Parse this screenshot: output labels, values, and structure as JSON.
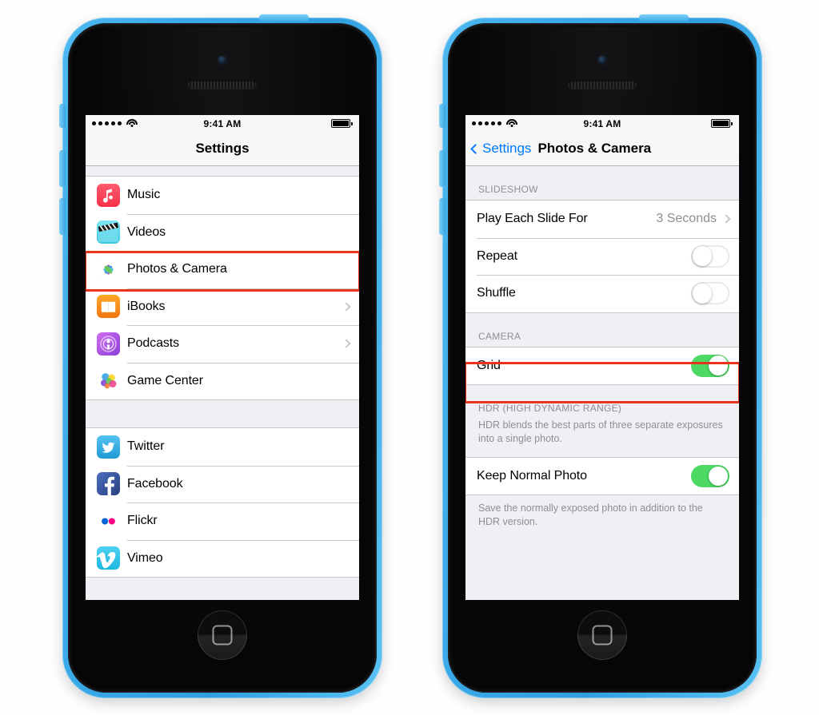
{
  "phones": {
    "left": {
      "status_bar": {
        "signal_dots": 5,
        "wifi": "wifi-icon",
        "time": "9:41 AM",
        "battery": "battery-full-icon"
      },
      "nav": {
        "title": "Settings"
      },
      "groups": [
        {
          "rows": [
            {
              "label": "Music",
              "icon": "music-app-icon",
              "accessory": "none"
            },
            {
              "label": "Videos",
              "icon": "videos-app-icon",
              "accessory": "none"
            },
            {
              "label": "Photos & Camera",
              "icon": "photos-app-icon",
              "accessory": "none",
              "highlighted": true
            },
            {
              "label": "iBooks",
              "icon": "ibooks-app-icon",
              "accessory": "chevron"
            },
            {
              "label": "Podcasts",
              "icon": "podcasts-app-icon",
              "accessory": "chevron"
            },
            {
              "label": "Game Center",
              "icon": "gamecenter-app-icon",
              "accessory": "none"
            }
          ]
        },
        {
          "rows": [
            {
              "label": "Twitter",
              "icon": "twitter-app-icon",
              "accessory": "none"
            },
            {
              "label": "Facebook",
              "icon": "facebook-app-icon",
              "accessory": "none"
            },
            {
              "label": "Flickr",
              "icon": "flickr-app-icon",
              "accessory": "none"
            },
            {
              "label": "Vimeo",
              "icon": "vimeo-app-icon",
              "accessory": "none"
            }
          ]
        }
      ]
    },
    "right": {
      "status_bar": {
        "signal_dots": 5,
        "wifi": "wifi-icon",
        "time": "9:41 AM",
        "battery": "battery-full-icon"
      },
      "nav": {
        "back_label": "Settings",
        "back_icon": "chevron-left-icon",
        "title": "Photos & Camera"
      },
      "sections": [
        {
          "header": "SLIDESHOW",
          "rows": [
            {
              "label": "Play Each Slide For",
              "value": "3 Seconds",
              "accessory": "chevron"
            },
            {
              "label": "Repeat",
              "accessory": "switch",
              "switch_on": false
            },
            {
              "label": "Shuffle",
              "accessory": "switch",
              "switch_on": false
            }
          ]
        },
        {
          "header": "CAMERA",
          "rows": [
            {
              "label": "Grid",
              "accessory": "switch",
              "switch_on": true,
              "highlighted": true
            }
          ]
        },
        {
          "header": "HDR (HIGH DYNAMIC RANGE)",
          "note": "HDR blends the best parts of three separate exposures into a single photo.",
          "rows": [
            {
              "label": "Keep Normal Photo",
              "accessory": "switch",
              "switch_on": true
            }
          ],
          "footnote": "Save the normally exposed photo in addition to the HDR version."
        }
      ]
    }
  },
  "colors": {
    "highlight": "#e8341c",
    "switch_on": "#4cd964",
    "tint_blue": "#007aff",
    "group_bg": "#efeff4",
    "device_blue": "#3aa9e8"
  }
}
